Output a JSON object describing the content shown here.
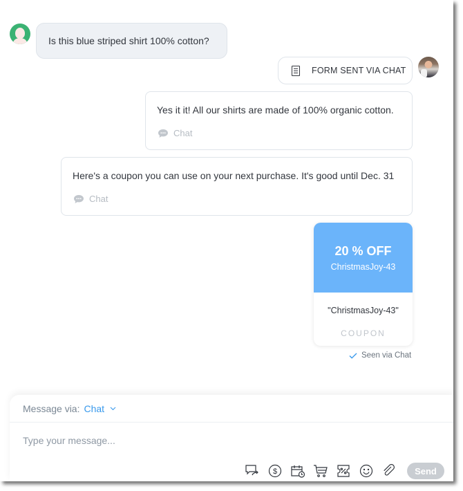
{
  "conversation": {
    "customer_message": {
      "text": "Is this blue striped shirt 100% cotton?",
      "avatar_icon": "customer-avatar-icon"
    },
    "form_event": {
      "label": "FORM SENT VIA CHAT",
      "icon": "document-icon"
    },
    "agent_messages": [
      {
        "text": "Yes it it! All our shirts are made of 100% organic cotton.",
        "channel": "Chat",
        "icon": "chat-bubble-icon"
      },
      {
        "text": "Here's a coupon you can use on your next purchase. It's good until Dec. 31",
        "channel": "Chat",
        "icon": "chat-bubble-icon"
      }
    ],
    "coupon": {
      "discount": "20 % OFF",
      "code_header": "ChristmasJoy-43",
      "code_quoted": "\"ChristmasJoy-43\"",
      "type_label": "COUPON",
      "color": "#6bb4fa"
    },
    "seen_status": "Seen via Chat"
  },
  "composer": {
    "via_label": "Message via:",
    "via_value": "Chat",
    "placeholder": "Type your message...",
    "toolbar_icons": [
      "forward-chat-icon",
      "payment-request-icon",
      "schedule-booking-icon",
      "cart-icon",
      "coupon-icon",
      "emoji-icon",
      "attachment-icon"
    ],
    "send_label": "Send"
  },
  "colors": {
    "accent": "#3899ec",
    "customer_avatar": "#3bb273",
    "send_disabled": "#c9cdd2"
  }
}
